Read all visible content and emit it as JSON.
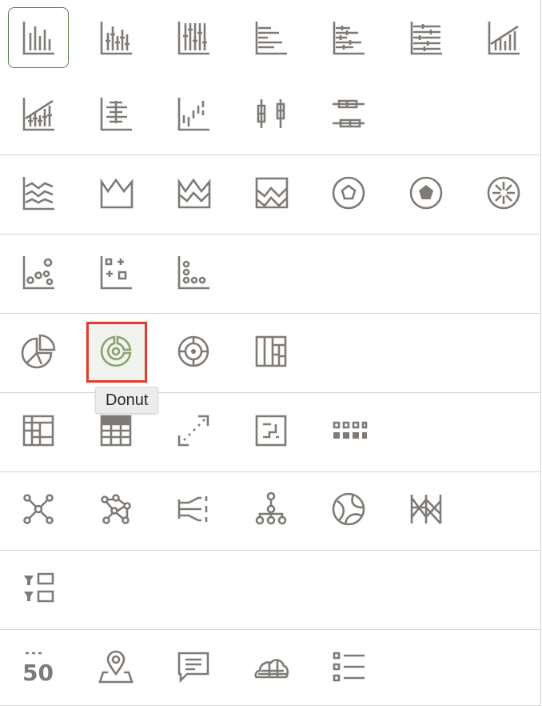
{
  "tooltip": {
    "text": "Donut"
  },
  "colors": {
    "icon": "#7f7a75",
    "selected_icon": "#8ca26f",
    "selected_border": "#5d7a47",
    "highlight_box": "#e23a2c"
  },
  "groups": [
    {
      "name": "bar-charts",
      "icons": [
        "bar-icon",
        "stacked-bar-icon",
        "percent-stacked-bar-icon",
        "horizontal-bar-icon",
        "horizontal-stacked-bar-icon",
        "horizontal-percent-stacked-bar-icon",
        "bar-line-combo-icon",
        "stacked-bar-line-icon",
        "horizontal-stacked-lines-icon",
        "waterfall-icon",
        "boxplot-icon",
        "horizontal-boxplot-icon"
      ]
    },
    {
      "name": "line-area-radar",
      "icons": [
        "line-icon",
        "area-icon",
        "stacked-area-icon",
        "percent-area-icon",
        "radar-icon",
        "filled-radar-icon",
        "radial-icon"
      ]
    },
    {
      "name": "scatter",
      "icons": [
        "scatter-icon",
        "grid-scatter-icon",
        "dot-plot-icon"
      ]
    },
    {
      "name": "pie-donut",
      "icons": [
        "pie-icon",
        "donut-icon",
        "sunburst-icon",
        "treemap-icon"
      ]
    },
    {
      "name": "tables-grids",
      "icons": [
        "pivot-table-icon",
        "table-icon",
        "correlation-icon",
        "tile-icon",
        "heatmap-icon"
      ]
    },
    {
      "name": "network-hierarchy",
      "icons": [
        "network-icon",
        "network-graph-icon",
        "sankey-icon",
        "hierarchy-icon",
        "chord-icon",
        "parallel-coordinates-icon"
      ]
    },
    {
      "name": "filters",
      "icons": [
        "filter-controls-icon"
      ]
    },
    {
      "name": "other",
      "icons": [
        "kpi-number-icon",
        "map-icon",
        "text-box-icon",
        "tag-cloud-icon",
        "list-icon"
      ]
    }
  ]
}
